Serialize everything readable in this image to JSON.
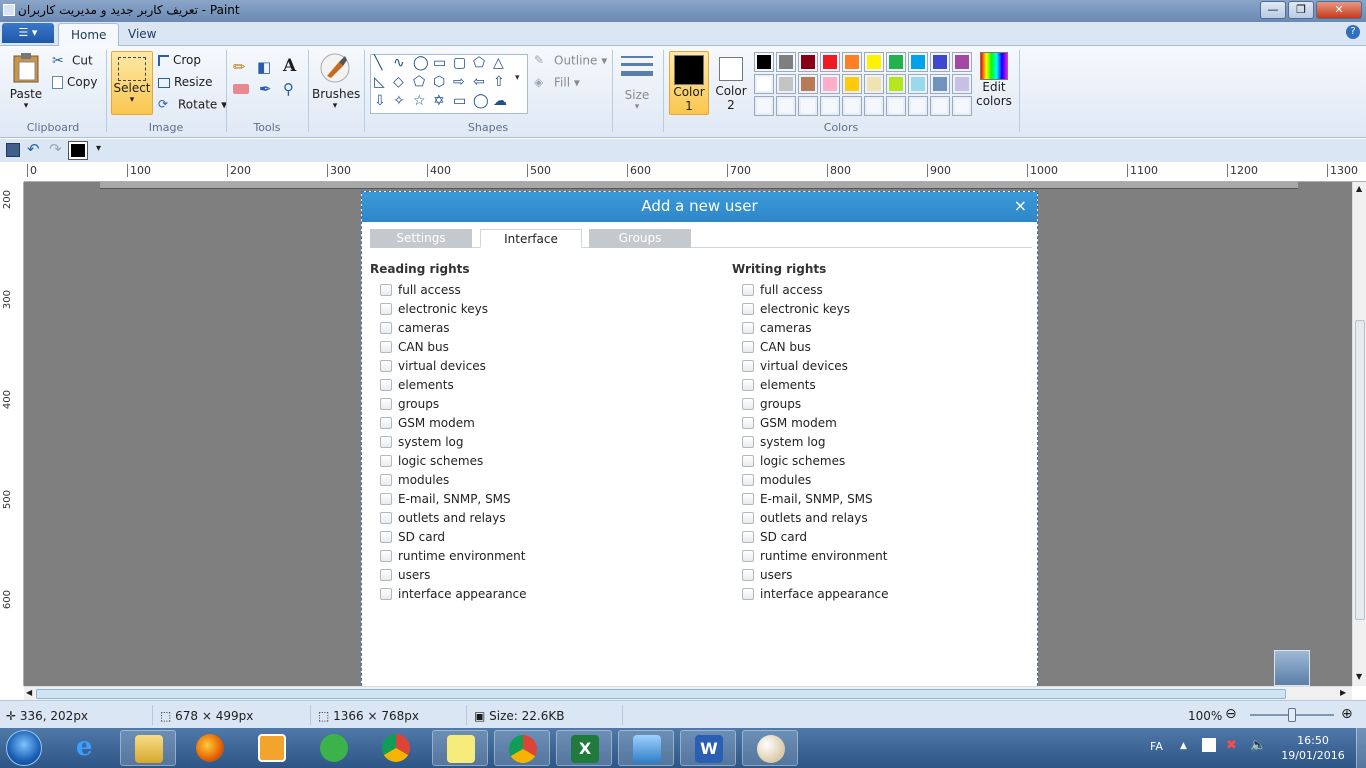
{
  "window": {
    "title": "تعریف کاربر جدید و مدیریت کاربران - Paint",
    "minimize": "—",
    "maximize": "❐",
    "close": "✕"
  },
  "ribbon_tabs": {
    "file": "☰ ▾",
    "home": "Home",
    "view": "View"
  },
  "clipboard": {
    "paste": "Paste",
    "cut": "Cut",
    "copy": "Copy",
    "group": "Clipboard"
  },
  "image": {
    "select": "Select",
    "crop": "Crop",
    "resize": "Resize",
    "rotate": "Rotate ▾",
    "group": "Image"
  },
  "tools": {
    "group": "Tools"
  },
  "brushes": {
    "label": "Brushes"
  },
  "shapes": {
    "outline": "Outline ▾",
    "fill": "Fill ▾",
    "group": "Shapes"
  },
  "size": {
    "label": "Size"
  },
  "colors": {
    "color1": "Color",
    "color1_num": "1",
    "color2": "Color",
    "color2_num": "2",
    "edit": "Edit",
    "edit2": "colors",
    "group": "Colors",
    "palette_row1": [
      "#000000",
      "#7f7f7f",
      "#880015",
      "#ed1c24",
      "#ff7f27",
      "#fff200",
      "#22b14c",
      "#00a2e8",
      "#3f48cc",
      "#a349a4"
    ],
    "palette_row2": [
      "#ffffff",
      "#c3c3c3",
      "#b97a57",
      "#ffaec9",
      "#ffc90e",
      "#efe4b0",
      "#b5e61d",
      "#99d9ea",
      "#7092be",
      "#c8bfe7"
    ]
  },
  "ruler_h": [
    "0",
    "100",
    "200",
    "300",
    "400",
    "500",
    "600",
    "700",
    "800",
    "900",
    "1000",
    "1100",
    "1200",
    "1300"
  ],
  "ruler_v": [
    "200",
    "300",
    "400",
    "500",
    "600"
  ],
  "dialog": {
    "title": "Add a new user",
    "close": "×",
    "tabs": [
      "Settings",
      "Interface",
      "Groups"
    ],
    "reading_title": "Reading rights",
    "writing_title": "Writing rights",
    "rights": [
      "full access",
      "electronic keys",
      "cameras",
      "CAN bus",
      "virtual devices",
      "elements",
      "groups",
      "GSM modem",
      "system log",
      "logic schemes",
      "modules",
      "E-mail, SNMP, SMS",
      "outlets and relays",
      "SD card",
      "runtime environment",
      "users",
      "interface appearance"
    ]
  },
  "status": {
    "cursor": "336, 202px",
    "selection": "678 × 499px",
    "image_size": "1366 × 768px",
    "file_size": "Size: 22.6KB",
    "zoom": "100%",
    "zoom_level": 1.0
  },
  "taskbar": {
    "lang": "FA",
    "time": "16:50",
    "date": "19/01/2016"
  }
}
